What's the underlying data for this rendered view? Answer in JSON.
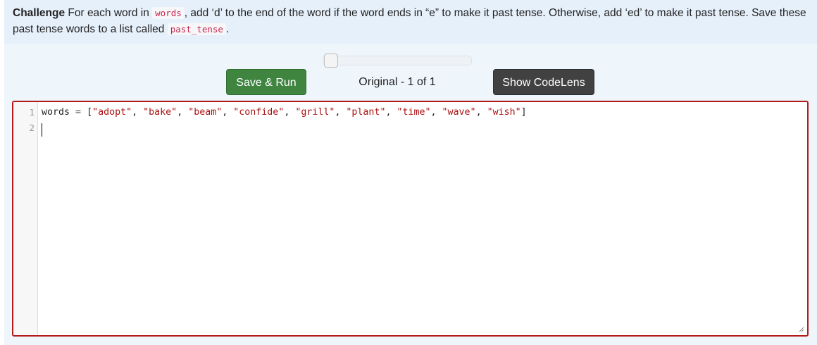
{
  "prompt": {
    "challenge_label": "Challenge",
    "text_1": " For each word in ",
    "code_1": "words",
    "text_2": ", add ‘d’ to the end of the word if the word ends in “e” to make it past tense. Otherwise, add ‘ed’ to make it past tense. Save these past tense words to a list called ",
    "code_2": "past_tense",
    "text_3": "."
  },
  "toolbar": {
    "run_label": "Save & Run",
    "version_label": "Original - 1 of 1",
    "codelens_label": "Show CodeLens"
  },
  "history_slider": {
    "position": 0
  },
  "editor": {
    "line_numbers": [
      "1",
      "2"
    ],
    "line1": {
      "name": "words",
      "eq": " = ",
      "open": "[",
      "items": [
        "\"adopt\"",
        "\"bake\"",
        "\"beam\"",
        "\"confide\"",
        "\"grill\"",
        "\"plant\"",
        "\"time\"",
        "\"wave\"",
        "\"wish\""
      ],
      "sep": ", ",
      "close": "]"
    },
    "line2": ""
  },
  "colors": {
    "run_button": "#3f8540",
    "codelens_button": "#414141",
    "editor_border": "#b31b1b",
    "string_token": "#aa1111"
  }
}
